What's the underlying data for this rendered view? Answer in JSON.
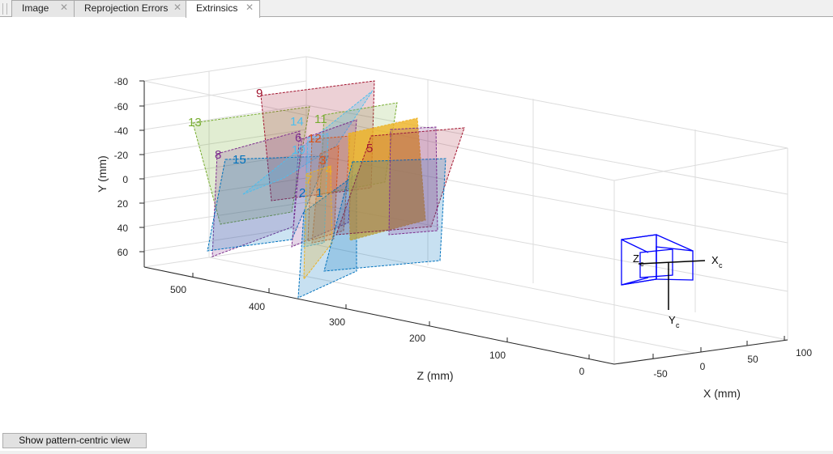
{
  "tabs": [
    {
      "label": "Image",
      "active": false,
      "close": "✕"
    },
    {
      "label": "Reprojection Errors",
      "active": false,
      "close": "✕"
    },
    {
      "label": "Extrinsics",
      "active": true,
      "close": "✕"
    }
  ],
  "button": {
    "label": "Show pattern-centric view"
  },
  "colors": {
    "blue": "#0072bd",
    "red": "#a2142f",
    "orange": "#d95319",
    "yellow": "#edb120",
    "purple": "#7e2f8e",
    "green": "#77ac30",
    "cyan": "#4dbeee",
    "camera": "#0000ff"
  },
  "chart_data": {
    "type": "3d-extrinsics",
    "axes": {
      "x": {
        "label": "X (mm)",
        "ticks": [
          "-50",
          "0",
          "50",
          "100"
        ]
      },
      "y": {
        "label": "Y (mm)",
        "ticks": [
          "-80",
          "-60",
          "-40",
          "-20",
          "0",
          "20",
          "40",
          "60"
        ]
      },
      "z": {
        "label": "Z (mm)",
        "ticks": [
          "500",
          "400",
          "300",
          "200",
          "100",
          "0"
        ]
      }
    },
    "camera_axes": {
      "x": "X",
      "y": "Y",
      "z": "Z",
      "subscript": "c"
    },
    "boards": [
      {
        "id": "1",
        "color": "#0072bd"
      },
      {
        "id": "2",
        "color": "#0072bd"
      },
      {
        "id": "3",
        "color": "#d95319"
      },
      {
        "id": "4",
        "color": "#edb120"
      },
      {
        "id": "5",
        "color": "#a2142f"
      },
      {
        "id": "6",
        "color": "#7e2f8e"
      },
      {
        "id": "7",
        "color": "#edb120"
      },
      {
        "id": "8",
        "color": "#7e2f8e"
      },
      {
        "id": "9",
        "color": "#a2142f"
      },
      {
        "id": "10",
        "color": "#4dbeee"
      },
      {
        "id": "11",
        "color": "#77ac30"
      },
      {
        "id": "12",
        "color": "#d95319"
      },
      {
        "id": "13",
        "color": "#77ac30"
      },
      {
        "id": "14",
        "color": "#4dbeee"
      },
      {
        "id": "15",
        "color": "#0072bd"
      }
    ]
  }
}
